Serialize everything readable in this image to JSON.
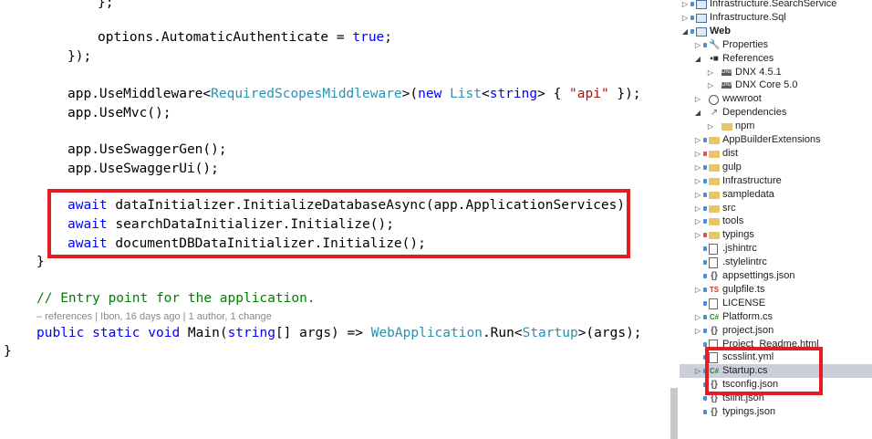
{
  "colors": {
    "keyword": "#0000ff",
    "type": "#2b91af",
    "string": "#a31515",
    "comment": "#008000",
    "highlight": "#e31d24",
    "selection": "#cccedb"
  },
  "code": {
    "l1": "};",
    "l2_pre": "options.AutomaticAuthenticate = ",
    "l2_kw": "true",
    "l2_post": ";",
    "l3": "});",
    "l4_a": "app.UseMiddleware<",
    "l4_t1": "RequiredScopesMiddleware",
    "l4_b": ">(",
    "l4_kw1": "new",
    "l4_c": " ",
    "l4_t2": "List",
    "l4_d": "<",
    "l4_kw2": "string",
    "l4_e": "> { ",
    "l4_str": "\"api\"",
    "l4_f": " });",
    "l5": "app.UseMvc();",
    "l6": "app.UseSwaggerGen();",
    "l7": "app.UseSwaggerUi();",
    "l8_kw": "await",
    "l8": " dataInitializer.InitializeDatabaseAsync(app.ApplicationServices);",
    "l9_kw": "await",
    "l9": " searchDataInitializer.Initialize();",
    "l10_kw": "await",
    "l10": " documentDBDataInitializer.Initialize();",
    "l11": "}",
    "l12_comment": "// Entry point for the application.",
    "lens_refs": "– references",
    "lens_sep1": " | ",
    "lens_author": "Ibon, 16 days ago",
    "lens_sep2": " | ",
    "lens_changes": "1 author, 1 change",
    "l13_kw1": "public",
    "l13_kw2": "static",
    "l13_kw3": "void",
    "l13_a": " Main(",
    "l13_kw4": "string",
    "l13_b": "[] args) => ",
    "l13_t1": "WebApplication",
    "l13_c": ".Run<",
    "l13_t2": "Startup",
    "l13_d": ">(args);",
    "l14": "}"
  },
  "tree": [
    {
      "label": "Infrastructure.SearchService"
    },
    {
      "label": "Infrastructure.Sql"
    },
    {
      "label": "Web"
    },
    {
      "label": "Properties"
    },
    {
      "label": "References"
    },
    {
      "label": "DNX 4.5.1",
      "badge": "DNX"
    },
    {
      "label": "DNX Core 5.0",
      "badge": "DNX"
    },
    {
      "label": "wwwroot"
    },
    {
      "label": "Dependencies"
    },
    {
      "label": "npm"
    },
    {
      "label": "AppBuilderExtensions"
    },
    {
      "label": "dist"
    },
    {
      "label": "gulp"
    },
    {
      "label": "Infrastructure"
    },
    {
      "label": "sampledata"
    },
    {
      "label": "src"
    },
    {
      "label": "tools"
    },
    {
      "label": "typings"
    },
    {
      "label": ".jshintrc"
    },
    {
      "label": ".stylelintrc"
    },
    {
      "label": "appsettings.json"
    },
    {
      "label": "gulpfile.ts",
      "badge": "TS"
    },
    {
      "label": "LICENSE"
    },
    {
      "label": "Platform.cs",
      "badge": "C#"
    },
    {
      "label": "project.json"
    },
    {
      "label": "Project_Readme.html"
    },
    {
      "label": "scsslint.yml"
    },
    {
      "label": "Startup.cs",
      "badge": "C#"
    },
    {
      "label": "tsconfig.json"
    },
    {
      "label": "tslint.json"
    },
    {
      "label": "typings.json"
    }
  ]
}
